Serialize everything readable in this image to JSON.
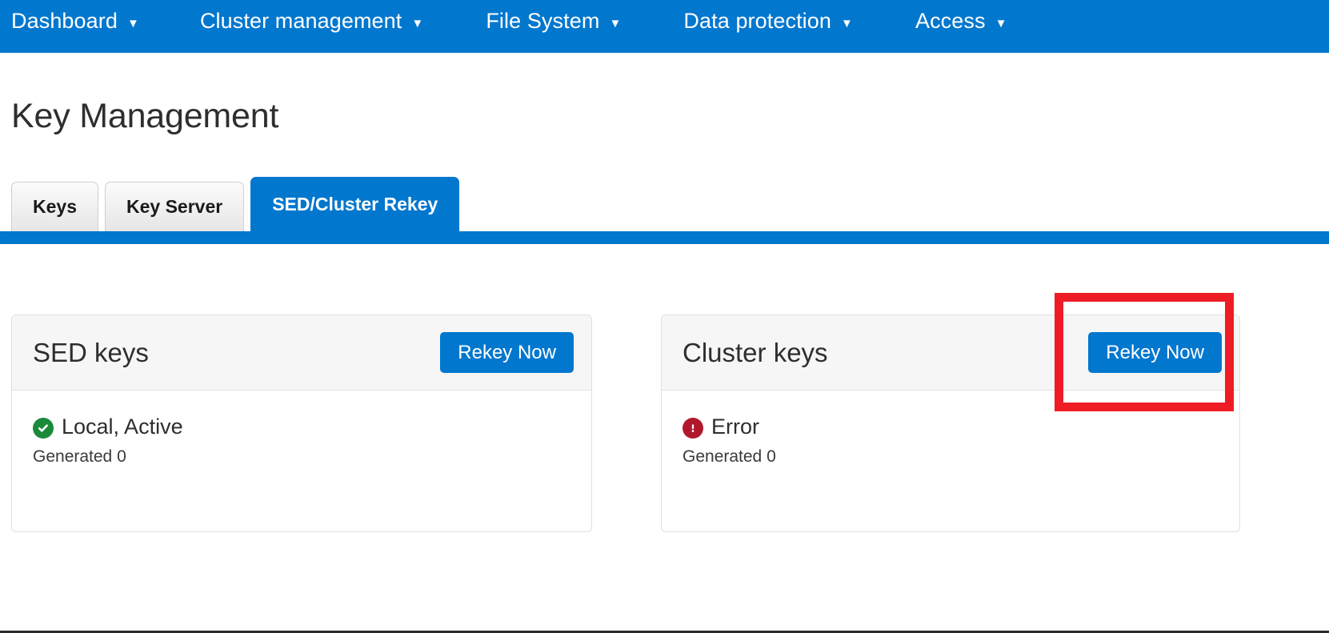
{
  "navbar": {
    "background_color": "#0277ce",
    "items": [
      {
        "label": "Dashboard",
        "caret": "▼"
      },
      {
        "label": "Cluster management",
        "caret": "▼"
      },
      {
        "label": "File System",
        "caret": "▼"
      },
      {
        "label": "Data protection",
        "caret": "▼"
      },
      {
        "label": "Access",
        "caret": "▼"
      }
    ]
  },
  "page": {
    "title": "Key Management"
  },
  "tabs": [
    {
      "label": "Keys",
      "active": false
    },
    {
      "label": "Key Server",
      "active": false
    },
    {
      "label": "SED/Cluster Rekey",
      "active": true
    }
  ],
  "cards": [
    {
      "title": "SED keys",
      "button_label": "Rekey Now",
      "status_text": "Local, Active",
      "status_type": "ok",
      "status_color": "#1a8a3a",
      "status_icon": "check-circle-icon",
      "generated_label": "Generated 0"
    },
    {
      "title": "Cluster keys",
      "button_label": "Rekey Now",
      "status_text": "Error",
      "status_type": "error",
      "status_color": "#b2182b",
      "status_icon": "exclamation-circle-icon",
      "generated_label": "Generated 0"
    }
  ],
  "annotation": {
    "highlight_color": "#ee1d25",
    "target": "cluster-keys-rekey-now-button"
  }
}
